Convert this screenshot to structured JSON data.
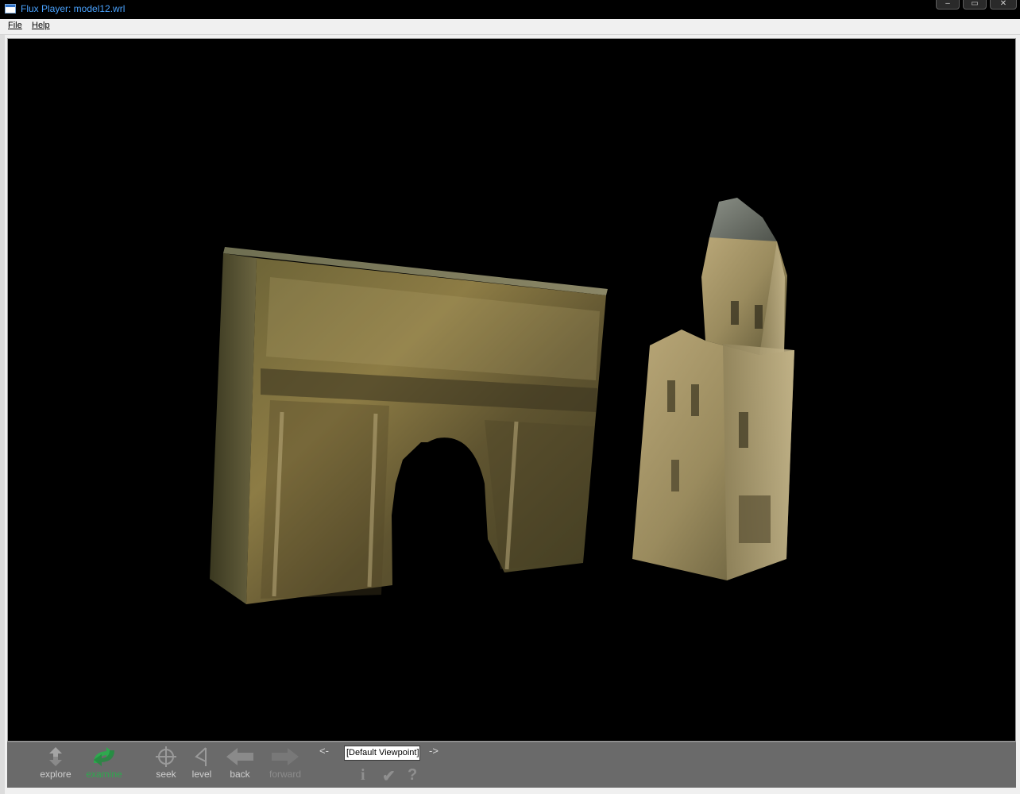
{
  "window": {
    "title": "Flux Player: model12.wrl",
    "controls": {
      "minimize": "–",
      "maximize": "▭",
      "close": "✕"
    }
  },
  "menu": {
    "file": "File",
    "help": "Help"
  },
  "viewport": {
    "background": "#000000",
    "models": [
      {
        "name": "triumphal-arch",
        "texture_color": "#7a6a3a"
      },
      {
        "name": "cathedral-tower",
        "texture_color": "#9c8a5c"
      }
    ]
  },
  "toolbar": {
    "tools": [
      {
        "id": "explore",
        "label": "explore",
        "icon": "explore-icon",
        "enabled": true
      },
      {
        "id": "examine",
        "label": "examine",
        "icon": "examine-icon",
        "active": true,
        "enabled": true
      },
      {
        "id": "seek",
        "label": "seek",
        "icon": "seek-icon",
        "enabled": true
      },
      {
        "id": "level",
        "label": "level",
        "icon": "level-icon",
        "enabled": true
      },
      {
        "id": "back",
        "label": "back",
        "icon": "back-arrow-icon",
        "enabled": true
      },
      {
        "id": "forward",
        "label": "forward",
        "icon": "forward-arrow-icon",
        "enabled": false
      }
    ],
    "viewpoint": {
      "prev": "<-",
      "next": "->",
      "current": "[Default Viewpoint]"
    },
    "extras": {
      "info": "i",
      "check": "✔",
      "help": "?"
    },
    "accent_active": "#2fa84f"
  }
}
